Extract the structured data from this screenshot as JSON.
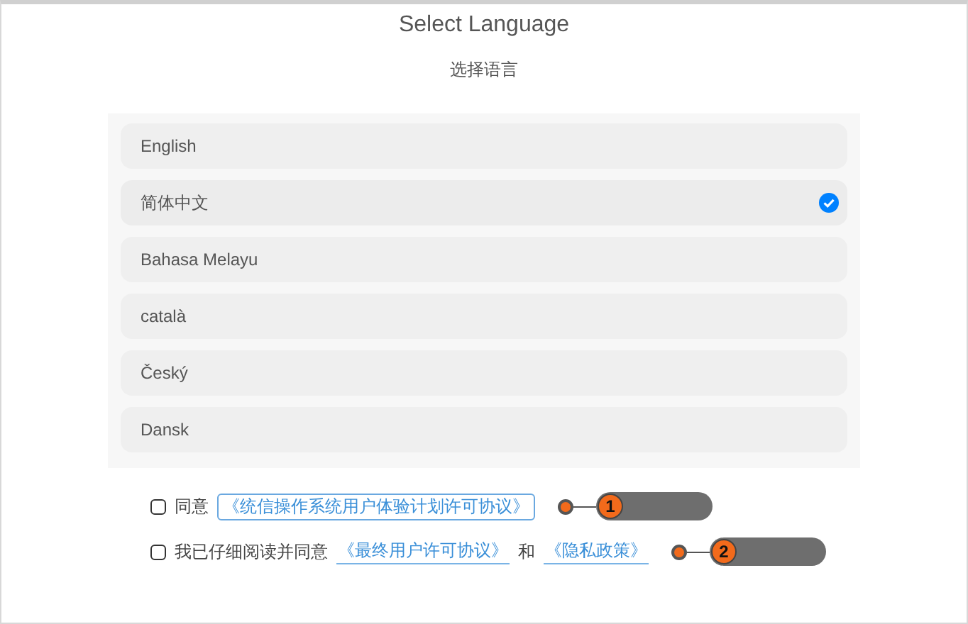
{
  "title": "Select Language",
  "subtitle": "选择语言",
  "languages": [
    {
      "label": "English",
      "selected": false
    },
    {
      "label": "简体中文",
      "selected": true
    },
    {
      "label": "Bahasa Melayu",
      "selected": false
    },
    {
      "label": "català",
      "selected": false
    },
    {
      "label": "Český",
      "selected": false
    },
    {
      "label": "Dansk",
      "selected": false
    }
  ],
  "agreements": [
    {
      "checked": false,
      "parts": [
        {
          "kind": "text",
          "text": "同意"
        },
        {
          "kind": "link",
          "text": "《统信操作系统用户体验计划许可协议》",
          "focused": true
        }
      ],
      "callout": "1"
    },
    {
      "checked": false,
      "parts": [
        {
          "kind": "text",
          "text": "我已仔细阅读并同意"
        },
        {
          "kind": "link",
          "text": "《最终用户许可协议》",
          "focused": false
        },
        {
          "kind": "text",
          "text": "和"
        },
        {
          "kind": "link",
          "text": "《隐私政策》",
          "focused": false
        }
      ],
      "callout": "2"
    }
  ]
}
